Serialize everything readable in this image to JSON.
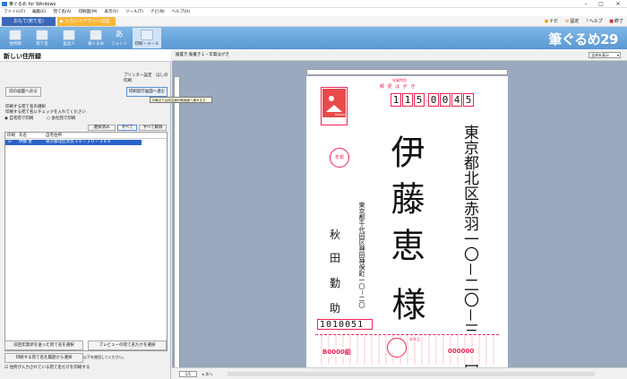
{
  "window": {
    "title": "筆ぐるめ for Windows"
  },
  "menu": [
    "ファイル(F)",
    "編集(E)",
    "宛て名(A)",
    "印刷面(M)",
    "表示(V)",
    "ツール(T)",
    "ナビ(N)",
    "ヘルプ(H)"
  ],
  "modebar": {
    "omote": "おもて(宛て名)",
    "layout": "▶ うらレイアウトへ切替"
  },
  "toplinks": {
    "navi": "ナビ",
    "settings": "設定",
    "help": "ヘルプ",
    "exit": "終了"
  },
  "ribbon": [
    {
      "label": "住所録"
    },
    {
      "label": "宛て名"
    },
    {
      "label": "差出人"
    },
    {
      "label": "筆ぐるめ"
    },
    {
      "label": "フォント"
    },
    {
      "label": "印刷・メール"
    }
  ],
  "brand": "筆ぐるめ29",
  "panel": {
    "title": "新しい住所録",
    "printer": "プリンター設定　ほしの印刷",
    "back_button": "前の画面へ戻る",
    "next_button": "印刷実行画面へ進む",
    "tooltip": "印刷または宛名面印刷画面へ進みます。",
    "section": "印刷する宛て名の選択",
    "instruction": "印刷する宛て名にチェックを入れてください",
    "radio1": "自宅宛で印刷",
    "radio2": "会社宛で印刷",
    "btn_select": "選択済み",
    "btn_all": "すべて",
    "btn_clear": "すべて解除",
    "columns": [
      "印刷",
      "氏名",
      "自宅住所"
    ],
    "rows": [
      {
        "name": "伊藤 恵",
        "address": "東京都北区赤羽 1 0 − 2 0 − 3 0 4"
      }
    ],
    "hint": "他の条件を使い印刷する宛て名を選択する場合は以下を使用してください。",
    "btn_prev_year": "前回年賀状を送った宛て名を選択",
    "btn_preview": "プレビューの宛て名だけを選択",
    "btn_history": "印刷する宛て名を履歴から選択",
    "checkbox": "住所が入力されている宛て名だけを印刷する"
  },
  "canvas": {
    "header_left": "縦置き 縦書き１・年賀はがき",
    "select": "全体を表示",
    "card_label": "郵 便 は が き",
    "card_top": "年賀特別",
    "postal": [
      "1",
      "1",
      "5",
      "0",
      "0",
      "4",
      "5"
    ],
    "recipient_address": "東京都北区赤羽一〇－二〇－三〇四",
    "recipient_name": "伊藤恵",
    "honorific": "様",
    "sender_address": "東京都千代田区神田神保町一〇－二〇",
    "sender_name1": "秋",
    "sender_name2": "田",
    "sender_name3": "勤",
    "sender_name4": "助",
    "sender_postal": "1010051",
    "stamp_text": "年賀",
    "nippon": "NIPPON",
    "lottery_left": "B0000組",
    "lottery_right": "000000",
    "otoshidama": "お年玉",
    "page": "1/1",
    "page_next": "次へ"
  }
}
